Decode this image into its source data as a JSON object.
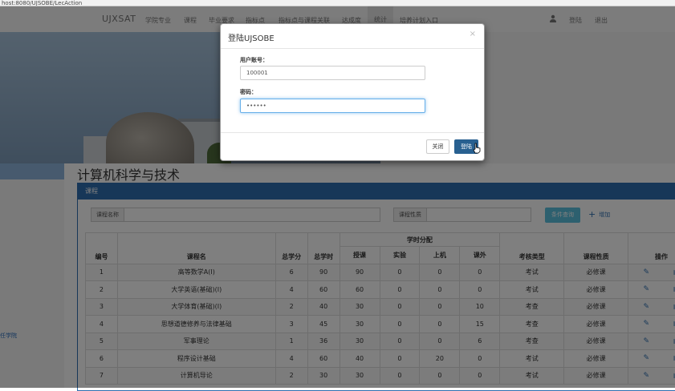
{
  "browser": {
    "url": "host:8080/UJSOBE/LecAction"
  },
  "navbar": {
    "brand": "UJXSAT",
    "items": [
      "学院专业",
      "课程",
      "毕业要求",
      "指标点",
      "指标点与课程关联",
      "达成度",
      "统计",
      "培养计划入口"
    ],
    "right_items": [
      "登陆",
      "退出"
    ]
  },
  "sidebar": {
    "link": "任学院"
  },
  "page": {
    "title": "计算机科学与技术"
  },
  "panel": {
    "title": "课程",
    "filter_name_label": "课程名称",
    "filter_type_label": "课程性质",
    "query_button": "条件查询",
    "add_link": "增加"
  },
  "table": {
    "group_header": "学时分配",
    "headers": [
      "编号",
      "课程名",
      "总学分",
      "总学时",
      "授课",
      "实验",
      "上机",
      "课外",
      "考核类型",
      "课程性质",
      "操作"
    ],
    "rows": [
      [
        "1",
        "高等数学A(I)",
        "6",
        "90",
        "90",
        "0",
        "0",
        "0",
        "考试",
        "必修课"
      ],
      [
        "2",
        "大学英语(基础)(I)",
        "4",
        "60",
        "60",
        "0",
        "0",
        "0",
        "考试",
        "必修课"
      ],
      [
        "3",
        "大学体育(基础)(I)",
        "2",
        "40",
        "30",
        "0",
        "0",
        "10",
        "考查",
        "必修课"
      ],
      [
        "4",
        "思想道德修养与法律基础",
        "3",
        "45",
        "30",
        "0",
        "0",
        "15",
        "考查",
        "必修课"
      ],
      [
        "5",
        "军事理论",
        "1",
        "36",
        "30",
        "0",
        "0",
        "6",
        "考查",
        "必修课"
      ],
      [
        "6",
        "程序设计基础",
        "4",
        "60",
        "40",
        "0",
        "20",
        "0",
        "考试",
        "必修课"
      ],
      [
        "7",
        "计算机导论",
        "2",
        "30",
        "30",
        "0",
        "0",
        "0",
        "考试",
        "必修课"
      ]
    ]
  },
  "modal": {
    "title": "登陆UJSOBE",
    "close_x": "×",
    "username_label": "用户账号：",
    "username_value": "100001",
    "password_label": "密码：",
    "password_value": "••••••",
    "close_button": "关闭",
    "login_button": "登陆"
  },
  "colors": {
    "primary": "#2f6fb0",
    "info": "#5bc0de",
    "login": "#286090"
  }
}
